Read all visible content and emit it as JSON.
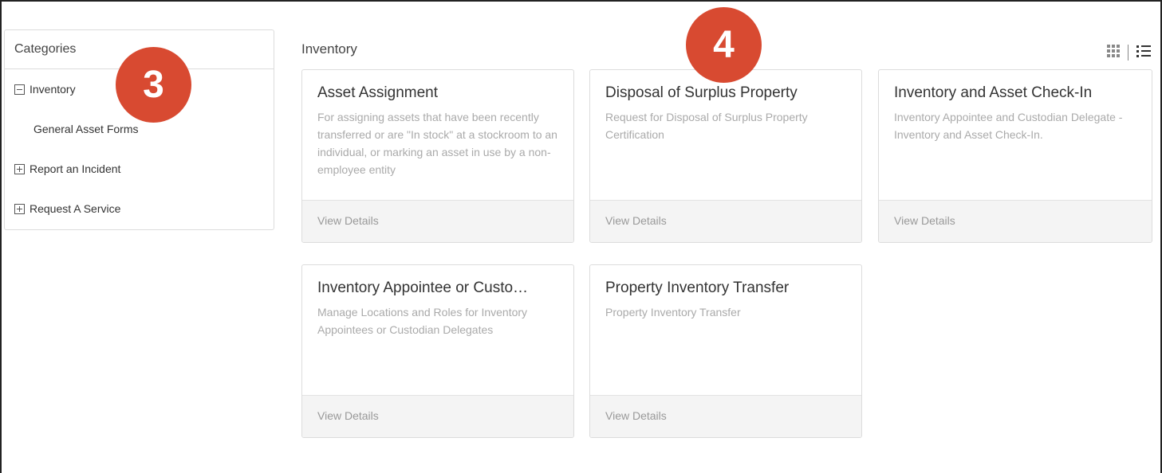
{
  "sidebar": {
    "header": "Categories",
    "items": [
      {
        "label": "Inventory",
        "toggle": "minus"
      },
      {
        "label": "General Asset Forms",
        "toggle": "none"
      },
      {
        "label": "Report an Incident",
        "toggle": "plus"
      },
      {
        "label": "Request A Service",
        "toggle": "plus"
      }
    ]
  },
  "main": {
    "title": "Inventory",
    "cards": [
      {
        "title": "Asset Assignment",
        "description": "For assigning assets that have been recently transferred or are \"In stock\" at a stockroom to an individual, or marking an asset in use by a non-employee entity",
        "footer": "View Details"
      },
      {
        "title": "Disposal of Surplus Property",
        "description": "Request for Disposal of Surplus Property Certification",
        "footer": "View Details"
      },
      {
        "title": "Inventory and Asset Check-In",
        "description": "Inventory Appointee and Custodian Delegate - Inventory and Asset Check-In.",
        "footer": "View Details"
      },
      {
        "title": "Inventory Appointee or Custo…",
        "description": "Manage Locations and Roles for Inventory Appointees or Custodian Delegates",
        "footer": "View Details"
      },
      {
        "title": "Property Inventory Transfer",
        "description": "Property Inventory Transfer",
        "footer": "View Details"
      }
    ]
  },
  "annotations": {
    "step3": "3",
    "step4": "4"
  },
  "colors": {
    "badge": "#d84a31",
    "card_footer_bg": "#f4f4f4",
    "description_text": "#aaaaaa"
  }
}
